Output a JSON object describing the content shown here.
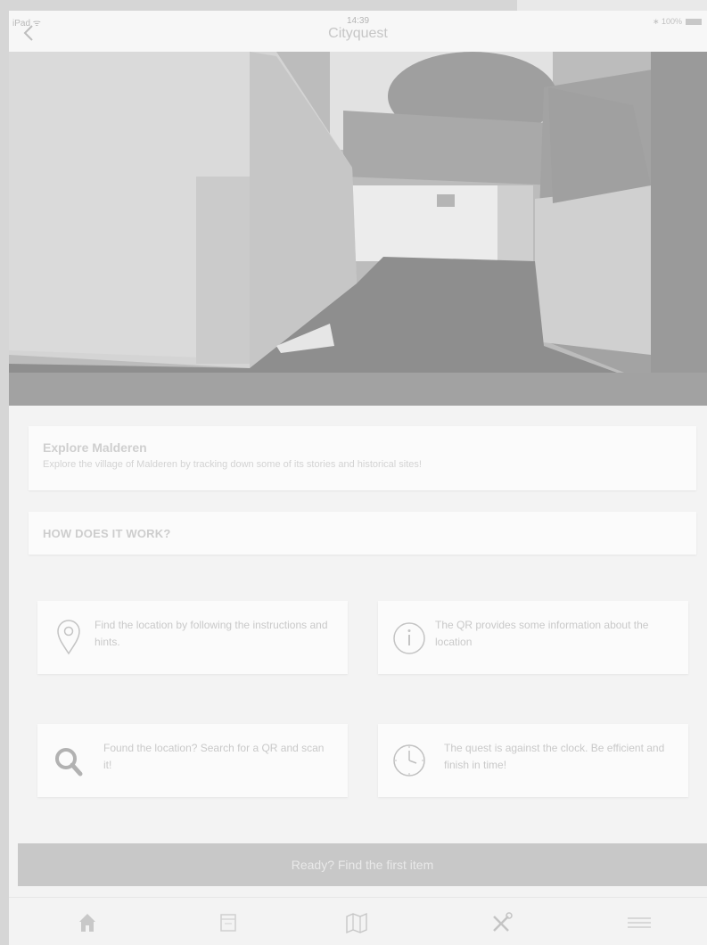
{
  "status_bar": {
    "carrier": "iPad ᯤ",
    "time": "14:39",
    "app_title": "Cityquest",
    "battery": "∗ 100%"
  },
  "intro": {
    "title": "Explore Malderen",
    "description": "Explore the village of Malderen by tracking down some of its stories and historical sites!"
  },
  "how": {
    "label": "HOW DOES IT WORK?"
  },
  "features": [
    {
      "icon": "location-pin-icon",
      "text": "Find the location by following the instructions and hints."
    },
    {
      "icon": "info-icon",
      "text": "The QR provides some information about the location"
    },
    {
      "icon": "search-icon",
      "text": "Found the location? Search for a QR and scan it!"
    },
    {
      "icon": "clock-icon",
      "text": "The quest is against the clock. Be efficient and finish in time!"
    }
  ],
  "cta": {
    "label": "Ready? Find the first item"
  },
  "tab_bar": {
    "tabs": [
      {
        "icon": "home-icon"
      },
      {
        "icon": "calendar-icon"
      },
      {
        "icon": "map-icon"
      },
      {
        "icon": "tools-icon"
      },
      {
        "icon": "menu-icon"
      }
    ]
  },
  "colors": {
    "background": "#f3f3f3",
    "card": "#fbfbfb",
    "cta": "#c8c8c8",
    "text_muted": "#c9c9c9"
  }
}
